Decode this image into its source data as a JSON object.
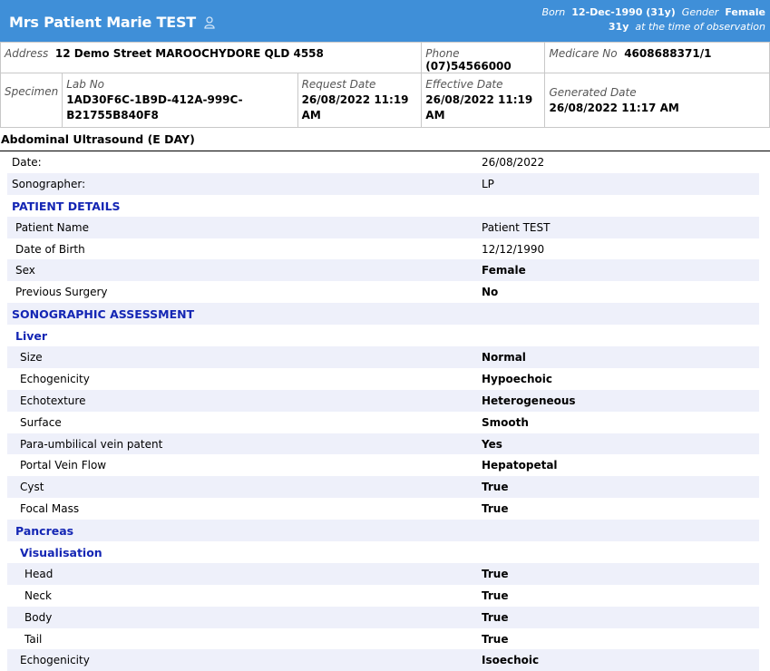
{
  "patient": {
    "name": "Mrs Patient Marie TEST",
    "born_label": "Born",
    "born_value": "12-Dec-1990 (31y)",
    "gender_label": "Gender",
    "gender_value": "Female",
    "age_value": "31y",
    "age_note": "at the time of observation"
  },
  "info": {
    "address_label": "Address",
    "address_value": "12 Demo Street MAROOCHYDORE QLD 4558",
    "phone_label": "Phone",
    "phone_value": "(07)54566000",
    "medicare_label": "Medicare No",
    "medicare_value": "4608688371/1",
    "specimen_label": "Specimen",
    "labno_label": "Lab No",
    "labno_value_1": "1AD30F6C-1B9D-412A-999C-",
    "labno_value_2": "B21755B840F8",
    "request_label": "Request Date",
    "request_value_1": "26/08/2022 11:19",
    "request_value_2": "AM",
    "effective_label": "Effective Date",
    "effective_value_1": "26/08/2022 11:19",
    "effective_value_2": "AM",
    "generated_label": "Generated Date",
    "generated_value": "26/08/2022 11:17 AM"
  },
  "report": {
    "title": "Abdominal Ultrasound (E DAY)",
    "rows": [
      {
        "k": "Date:",
        "v": "26/08/2022"
      },
      {
        "k": "Sonographer:",
        "v": "LP"
      },
      {
        "k": "PATIENT DETAILS",
        "v": ""
      },
      {
        "k": "Patient Name",
        "v": "Patient TEST"
      },
      {
        "k": "Date of Birth",
        "v": "12/12/1990"
      },
      {
        "k": "Sex",
        "v": "Female"
      },
      {
        "k": "Previous Surgery",
        "v": "No"
      },
      {
        "k": "SONOGRAPHIC ASSESSMENT",
        "v": ""
      },
      {
        "k": "Liver",
        "v": ""
      },
      {
        "k": "Size",
        "v": "Normal"
      },
      {
        "k": "Echogenicity",
        "v": "Hypoechoic"
      },
      {
        "k": "Echotexture",
        "v": "Heterogeneous"
      },
      {
        "k": "Surface",
        "v": "Smooth"
      },
      {
        "k": "Para-umbilical vein patent",
        "v": "Yes"
      },
      {
        "k": "Portal Vein Flow",
        "v": "Hepatopetal"
      },
      {
        "k": "Cyst",
        "v": "True"
      },
      {
        "k": "Focal Mass",
        "v": "True"
      },
      {
        "k": "Pancreas",
        "v": ""
      },
      {
        "k": "Visualisation",
        "v": ""
      },
      {
        "k": "Head",
        "v": "True"
      },
      {
        "k": "Neck",
        "v": "True"
      },
      {
        "k": "Body",
        "v": "True"
      },
      {
        "k": "Tail",
        "v": "True"
      },
      {
        "k": "Echogenicity",
        "v": "Isoechoic"
      }
    ]
  },
  "colors": {
    "banner": "#3f8fd8",
    "heading": "#1426b4",
    "row_alt": "#eef0fa"
  }
}
